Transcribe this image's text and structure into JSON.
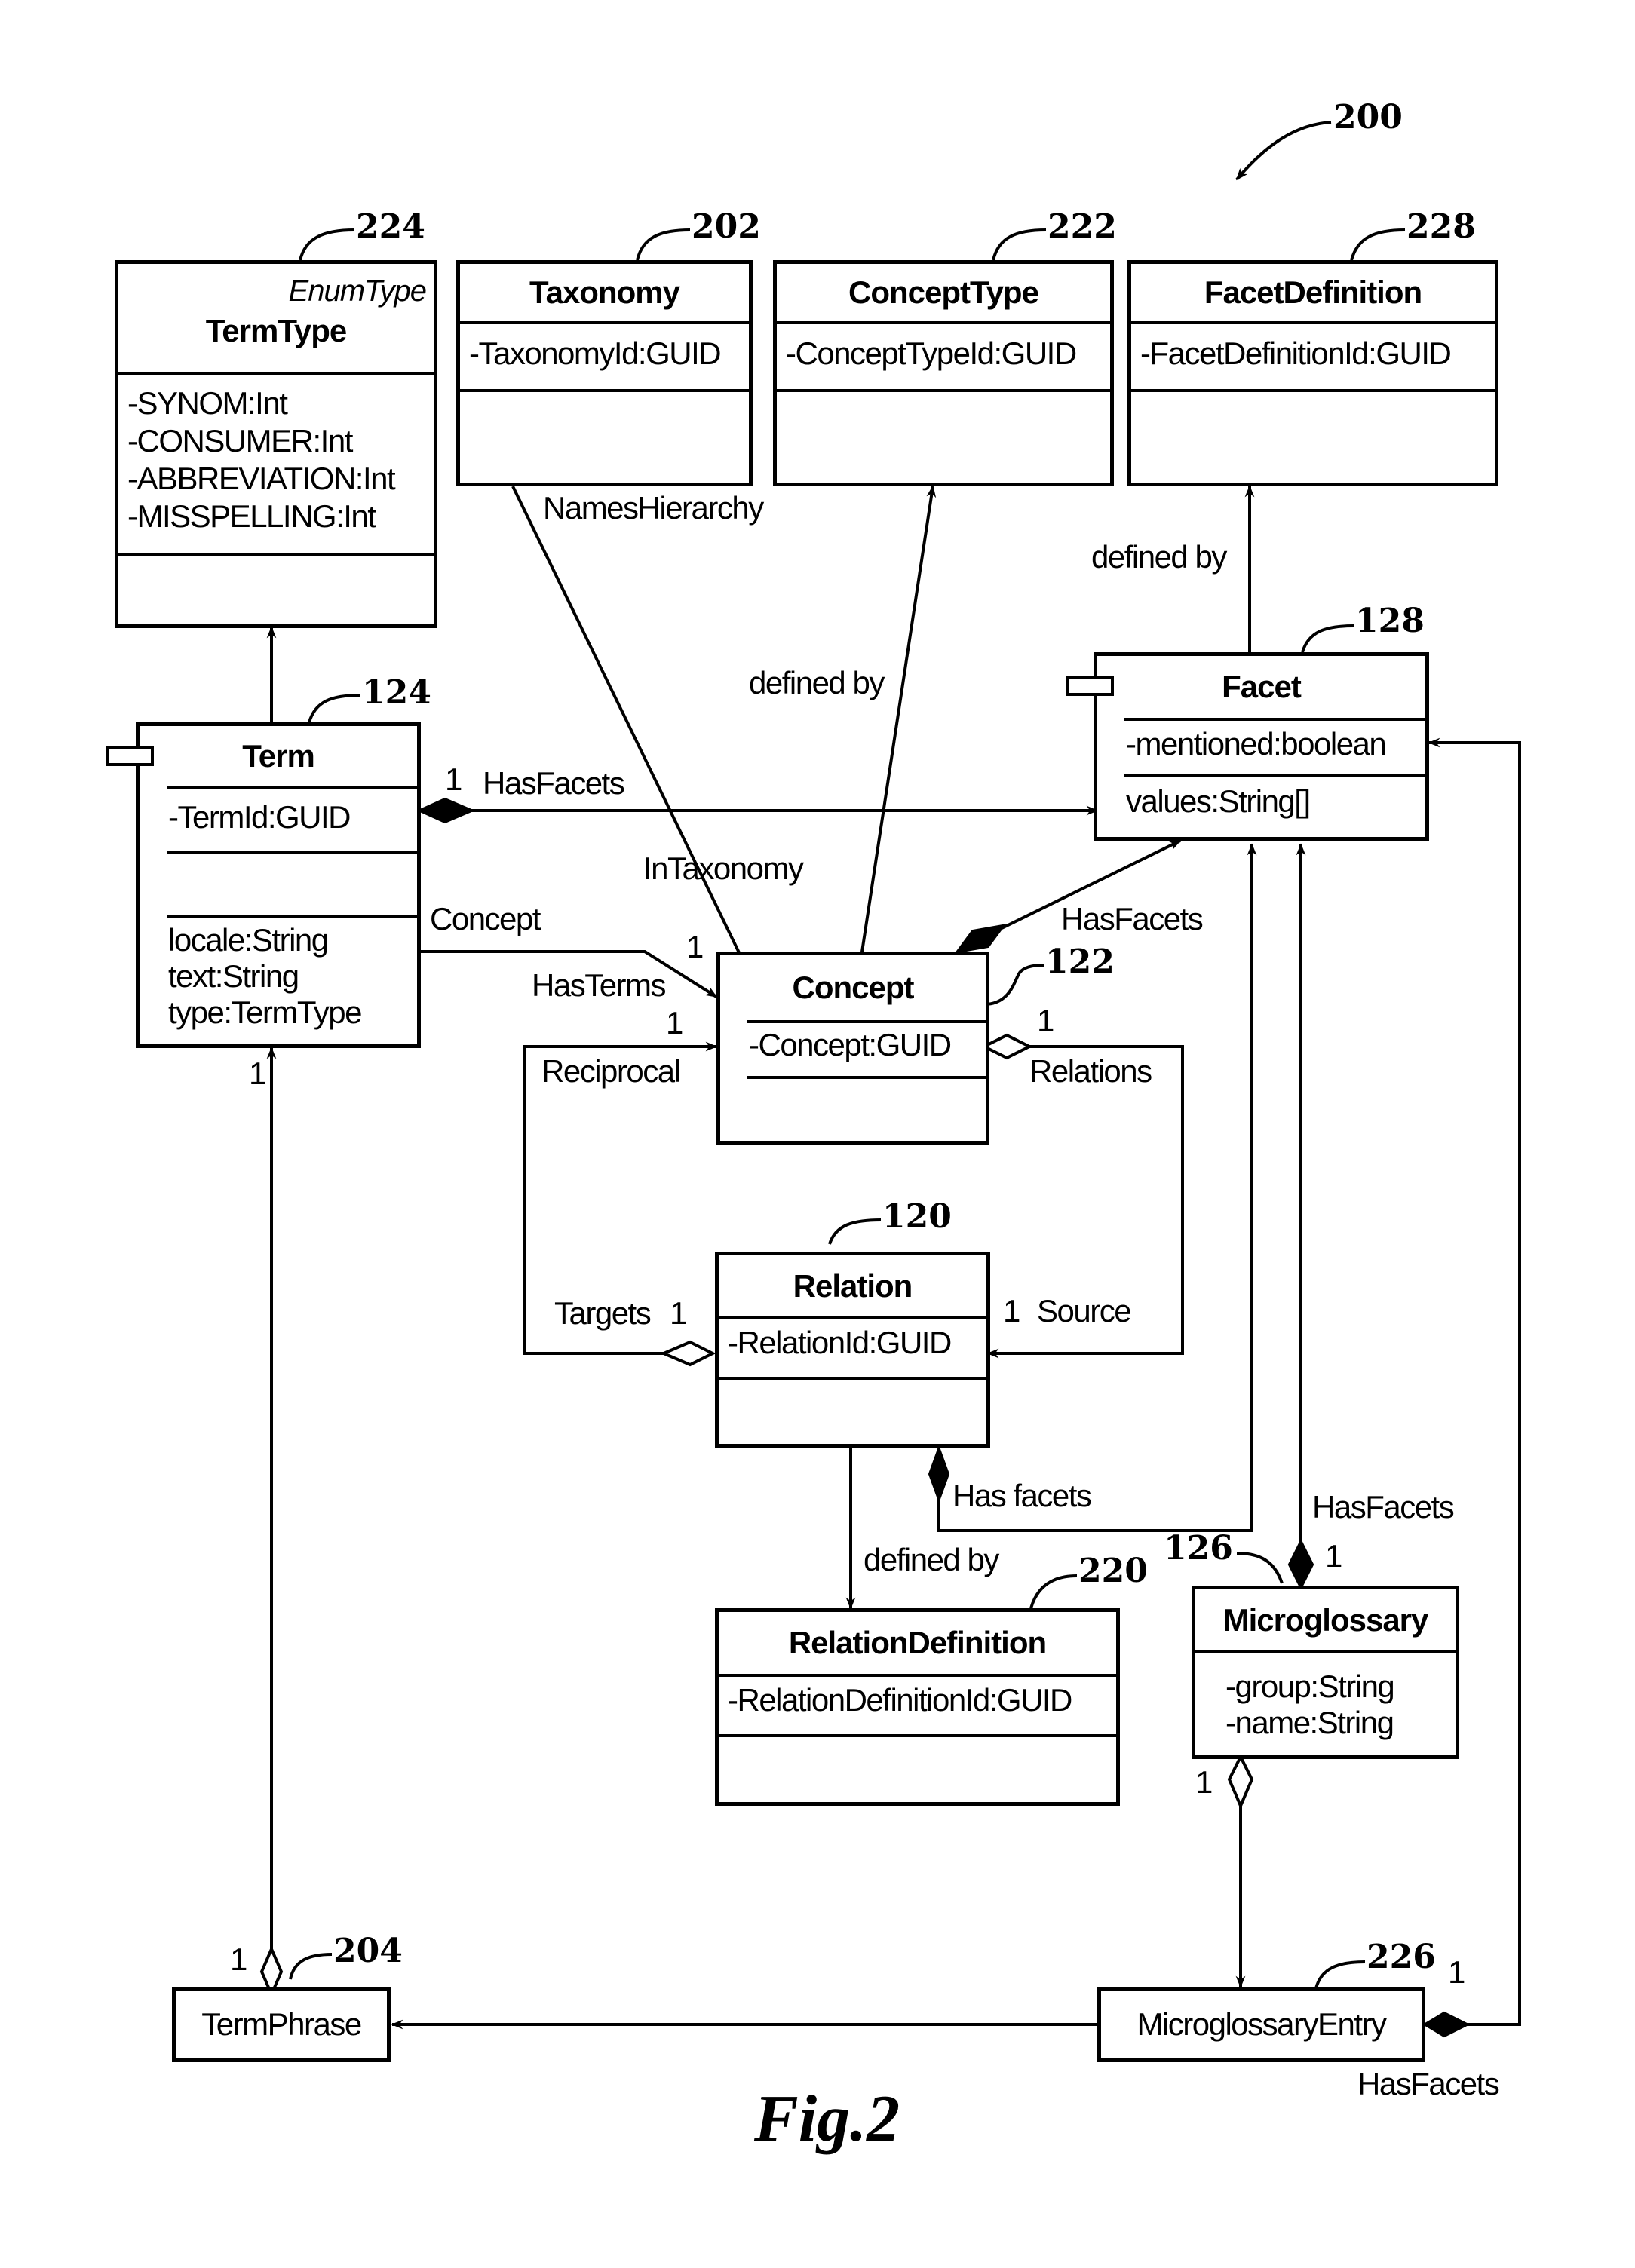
{
  "figure": {
    "caption": "Fig.2",
    "ref": "200"
  },
  "classes": {
    "termtype": {
      "ref": "224",
      "stereotype": "EnumType",
      "name": "TermType",
      "attributes": [
        "-SYNOM:Int",
        "-CONSUMER:Int",
        "-ABBREVIATION:Int",
        "-MISSPELLING:Int"
      ]
    },
    "taxonomy": {
      "ref": "202",
      "name": "Taxonomy",
      "attributes": [
        "-TaxonomyId:GUID"
      ]
    },
    "concepttype": {
      "ref": "222",
      "name": "ConceptType",
      "attributes": [
        "-ConceptTypeId:GUID"
      ]
    },
    "facetdefinition": {
      "ref": "228",
      "name": "FacetDefinition",
      "attributes": [
        "-FacetDefinitionId:GUID"
      ]
    },
    "term": {
      "ref": "124",
      "name": "Term",
      "attributes": [
        "-TermId:GUID"
      ],
      "operations": [
        "locale:String",
        "text:String",
        "type:TermType"
      ]
    },
    "facet": {
      "ref": "128",
      "name": "Facet",
      "attributes": [
        "-mentioned:boolean"
      ],
      "operations": [
        "values:String[]"
      ]
    },
    "concept": {
      "ref": "122",
      "name": "Concept",
      "attributes": [
        "-Concept:GUID"
      ]
    },
    "relation": {
      "ref": "120",
      "name": "Relation",
      "attributes": [
        "-RelationId:GUID"
      ]
    },
    "relationdefinition": {
      "ref": "220",
      "name": "RelationDefinition",
      "attributes": [
        "-RelationDefinitionId:GUID"
      ]
    },
    "microglossary": {
      "ref": "126",
      "name": "Microglossary",
      "attributes": [
        "-group:String",
        "-name:String"
      ]
    },
    "termphrase": {
      "ref": "204",
      "name": "TermPhrase"
    },
    "microglossaryentry": {
      "ref": "226",
      "name": "MicroglossaryEntry"
    }
  },
  "associations": {
    "names_hierarchy": "NamesHierarchy",
    "in_taxonomy": "InTaxonomy",
    "concept_defined_by": "defined by",
    "facet_defined_by": "defined by",
    "term_has_facets": "HasFacets",
    "term_has_facets_mult": "1",
    "concept_label": "Concept",
    "has_terms": "HasTerms",
    "concept_mult_top": "1",
    "concept_mult_hasterms": "1",
    "concept_has_facets": "HasFacets",
    "reciprocal": "Reciprocal",
    "relations": "Relations",
    "relations_mult": "1",
    "targets": "Targets",
    "targets_mult": "1",
    "source": "Source",
    "source_mult": "1",
    "relation_has_facets": "Has facets",
    "relation_defined_by": "defined by",
    "microglossary_has_facets": "HasFacets",
    "microglossary_has_facets_mult": "1",
    "microglossary_entry_mult": "1",
    "term_termphrase_mult": "1",
    "termphrase_mult": "1",
    "entry_has_facets": "HasFacets",
    "entry_has_facets_mult": "1"
  }
}
